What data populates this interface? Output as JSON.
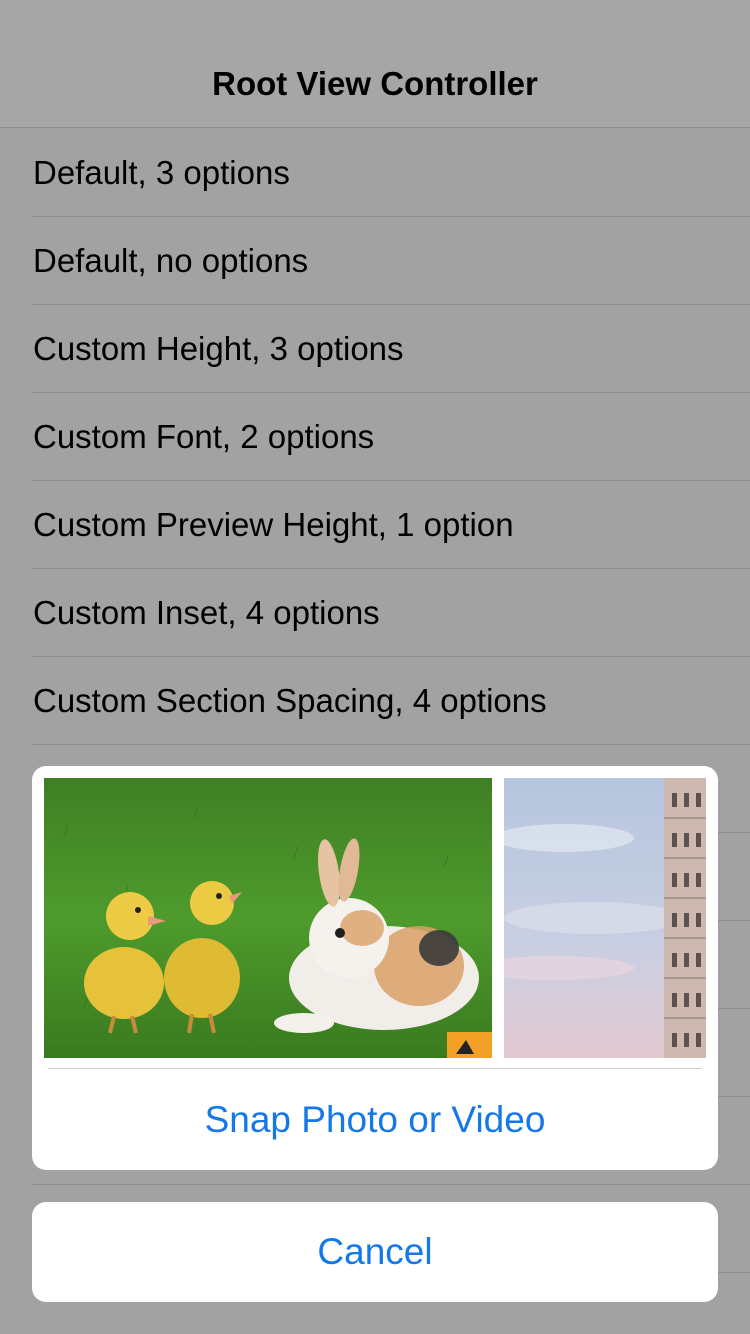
{
  "navbar": {
    "title": "Root View Controller"
  },
  "rows": [
    {
      "label": "Default, 3 options"
    },
    {
      "label": "Default, no options"
    },
    {
      "label": "Custom Height, 3 options"
    },
    {
      "label": "Custom Font, 2 options"
    },
    {
      "label": "Custom Preview Height, 1 option"
    },
    {
      "label": "Custom Inset, 4 options"
    },
    {
      "label": "Custom Section Spacing, 4 options"
    },
    {
      "label": ""
    },
    {
      "label": ""
    },
    {
      "label": ""
    },
    {
      "label": ""
    },
    {
      "label": ""
    },
    {
      "label": ""
    }
  ],
  "sheet": {
    "photos": [
      {
        "subject": "ducklings and rabbit on grass"
      },
      {
        "subject": "leaning tower against cloudy sky"
      }
    ],
    "action_label": "Snap Photo or Video"
  },
  "cancel_label": "Cancel",
  "colors": {
    "accent": "#1478ea",
    "dim_background": "#a2a2a2"
  }
}
